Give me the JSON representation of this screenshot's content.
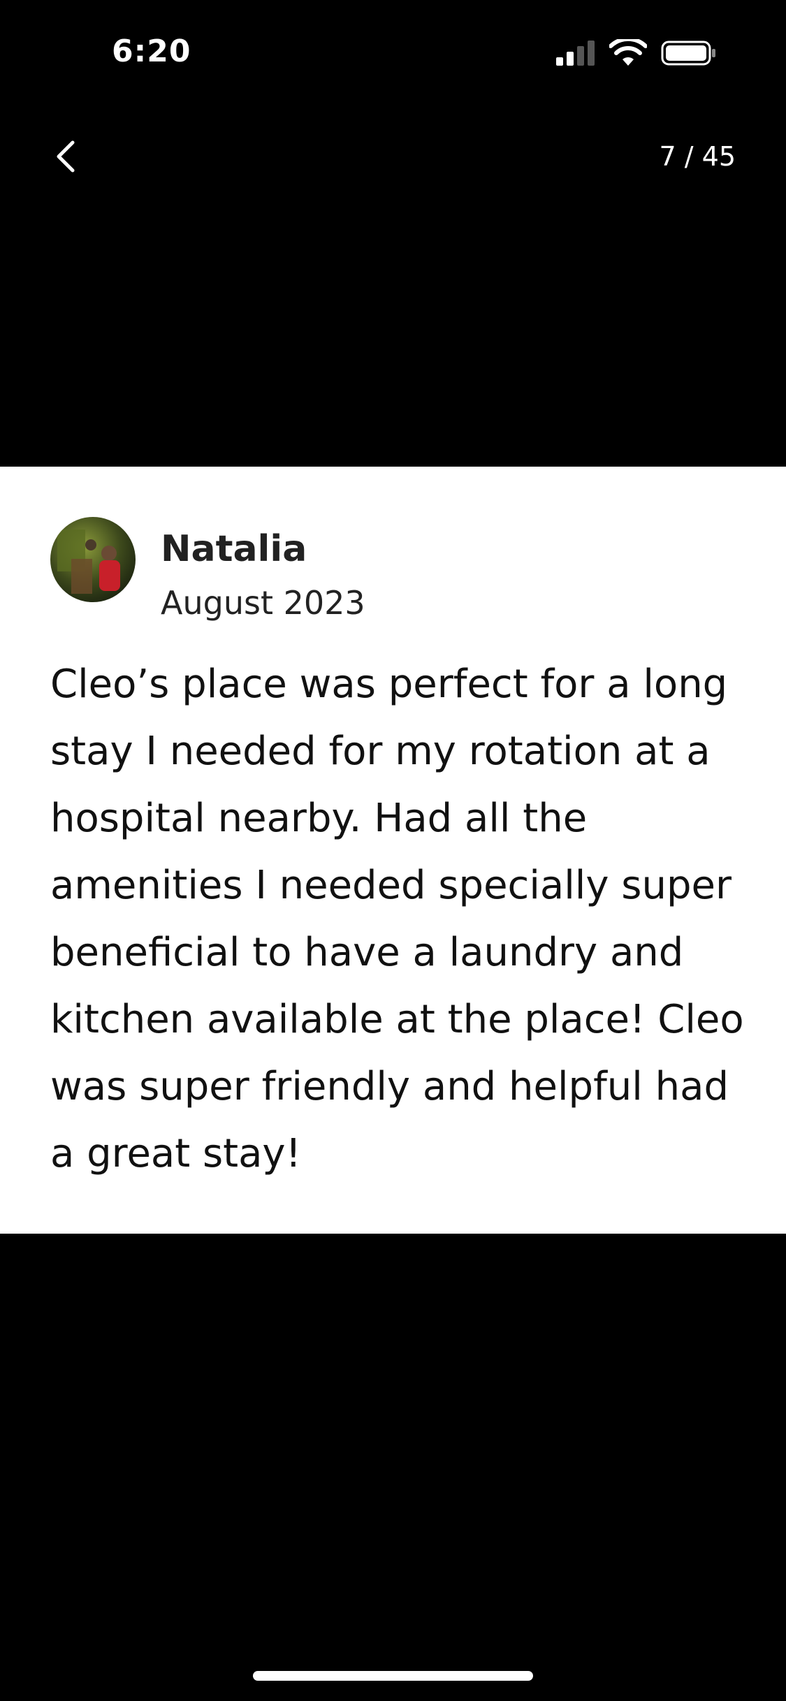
{
  "status_bar": {
    "time": "6:20"
  },
  "nav": {
    "back_icon": "chevron-left-icon",
    "page_counter": "7 / 45"
  },
  "review": {
    "reviewer_name": "Natalia",
    "date": "August 2023",
    "text": "Cleo’s place was perfect for a long stay I needed for my rotation at a hospital nearby. Had all the amenities I needed specially super beneficial to have a laundry and kitchen available at the place! Cleo was super friendly and helpful had a great stay!"
  },
  "colors": {
    "background": "#000000",
    "card": "#ffffff",
    "text": "#111111"
  }
}
